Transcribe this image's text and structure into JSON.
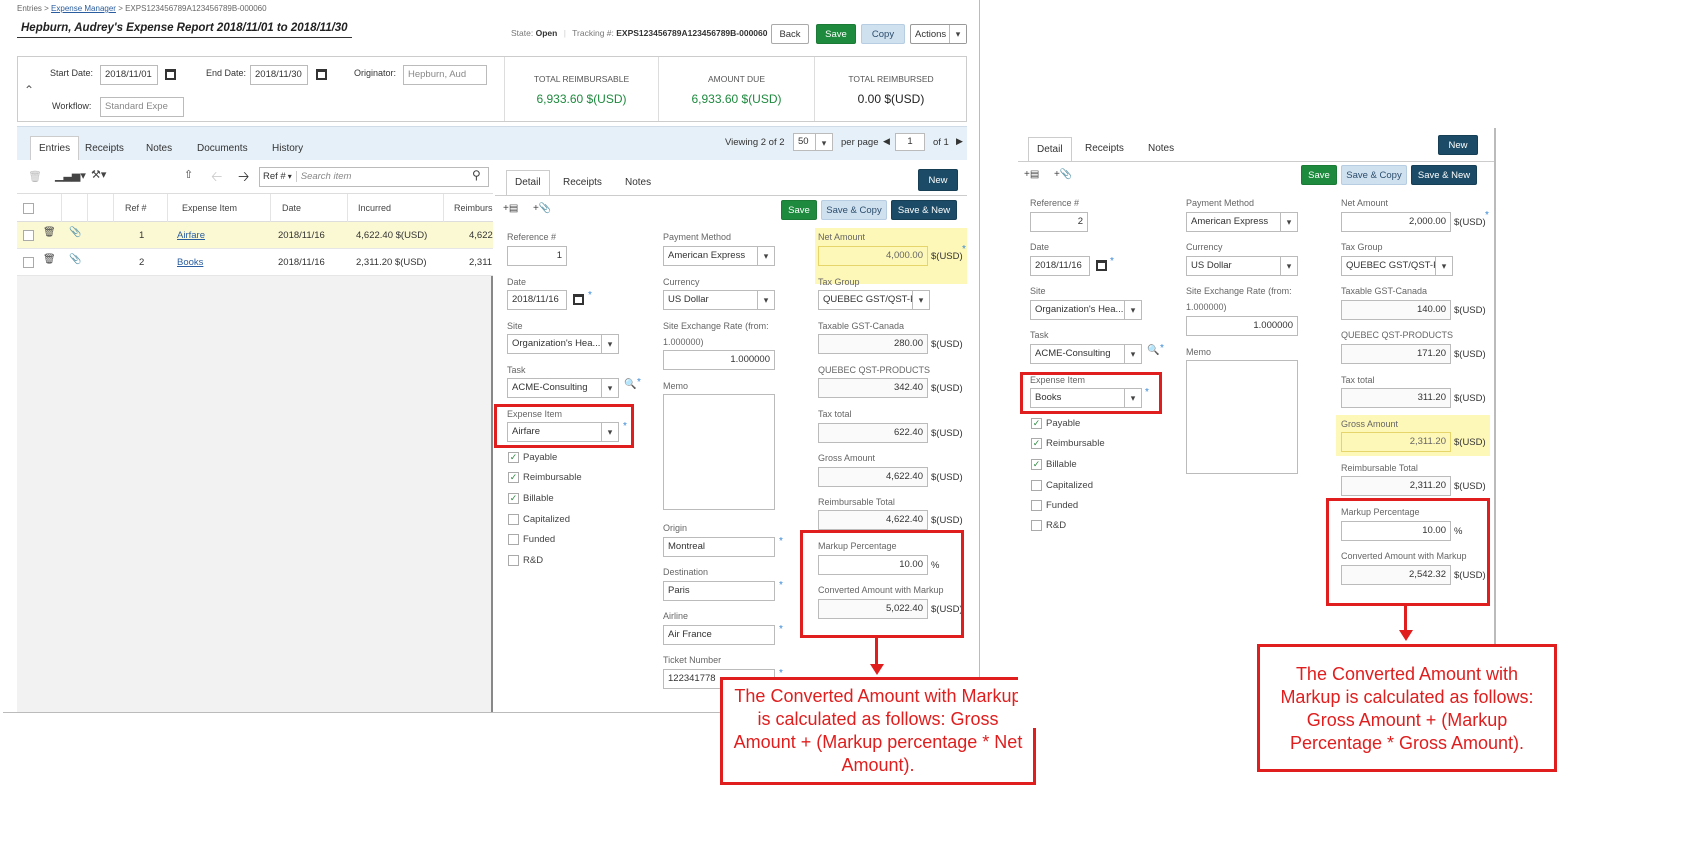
{
  "main": {
    "breadcrumb": {
      "root": "Entries >",
      "link": "Expense Manager",
      "rest": "> EXPS123456789A123456789B-000060"
    },
    "title": "Hepburn, Audrey's Expense Report 2018/11/01 to 2018/11/30",
    "state_label": "State:",
    "state_value": "Open",
    "tracking_label": "Tracking #:",
    "tracking_value": "EXPS123456789A123456789B-000060",
    "buttons": {
      "back": "Back",
      "save": "Save",
      "copy": "Copy",
      "actions": "Actions"
    },
    "header": {
      "start_label": "Start Date:",
      "start_value": "2018/11/01",
      "end_label": "End Date:",
      "end_value": "2018/11/30",
      "originator_label": "Originator:",
      "originator_value": "Hepburn, Aud",
      "workflow_label": "Workflow:",
      "workflow_value": "Standard Expe"
    },
    "totals": [
      {
        "label": "TOTAL REIMBURSABLE",
        "value": "6,933.60 $(USD)"
      },
      {
        "label": "AMOUNT DUE",
        "value": "6,933.60 $(USD)"
      },
      {
        "label": "TOTAL REIMBURSED",
        "value": "0.00 $(USD)"
      }
    ],
    "tabs": {
      "entries": "Entries",
      "receipts": "Receipts",
      "notes": "Notes",
      "documents": "Documents",
      "history": "History"
    },
    "paging": {
      "viewing": "Viewing 2 of 2",
      "per_page_value": "50",
      "per_page_label": "per page",
      "page": "1",
      "of": "of 1"
    },
    "search": {
      "field": "Ref #",
      "placeholder": "Search item"
    },
    "columns": {
      "ref": "Ref #",
      "item": "Expense Item",
      "date": "Date",
      "incurred": "Incurred",
      "reimb": "Reimburs"
    },
    "rows": [
      {
        "ref": "1",
        "item": "Airfare",
        "date": "2018/11/16",
        "incurred": "4,622.40 $(USD)",
        "reimb": "4,622"
      },
      {
        "ref": "2",
        "item": "Books",
        "date": "2018/11/16",
        "incurred": "2,311.20 $(USD)",
        "reimb": "2,311"
      }
    ]
  },
  "detail_left": {
    "tabs": {
      "detail": "Detail",
      "receipts": "Receipts",
      "notes": "Notes"
    },
    "buttons": {
      "new": "New",
      "save": "Save",
      "save_copy": "Save & Copy",
      "save_new": "Save & New"
    },
    "labels": {
      "ref": "Reference #",
      "date": "Date",
      "site": "Site",
      "task": "Task",
      "expense_item": "Expense Item",
      "payment": "Payment Method",
      "currency": "Currency",
      "rate": "Site Exchange Rate",
      "rate_from": "(from:",
      "rate_from_value": "1.000000)",
      "memo": "Memo",
      "origin": "Origin",
      "destination": "Destination",
      "airline": "Airline",
      "ticket": "Ticket Number",
      "net": "Net Amount",
      "tax_group": "Tax Group",
      "taxable_gst": "Taxable GST-Canada",
      "qst": "QUEBEC QST-PRODUCTS",
      "tax_total": "Tax total",
      "gross": "Gross Amount",
      "reimb_total": "Reimbursable Total",
      "markup": "Markup Percentage",
      "converted": "Converted Amount with Markup"
    },
    "values": {
      "ref": "1",
      "date": "2018/11/16",
      "site": "Organization's Hea...",
      "task": "ACME-Consulting",
      "expense_item": "Airfare",
      "payment": "American Express",
      "currency": "US Dollar",
      "rate": "1.000000",
      "origin": "Montreal",
      "destination": "Paris",
      "airline": "Air France",
      "ticket": "122341778",
      "net": "4,000.00",
      "tax_group": "QUEBEC GST/QST-P...",
      "taxable_gst": "280.00",
      "qst": "342.40",
      "tax_total": "622.40",
      "gross": "4,622.40",
      "reimb_total": "4,622.40",
      "markup": "10.00",
      "converted": "5,022.40"
    },
    "unit": "$(USD)",
    "pct": "%",
    "checks": [
      {
        "label": "Payable",
        "checked": true
      },
      {
        "label": "Reimbursable",
        "checked": true
      },
      {
        "label": "Billable",
        "checked": true
      },
      {
        "label": "Capitalized",
        "checked": false
      },
      {
        "label": "Funded",
        "checked": false
      },
      {
        "label": "R&D",
        "checked": false
      }
    ],
    "callout": "The Converted Amount with Markup is calculated as follows: Gross Amount + (Markup percentage * Net Amount)."
  },
  "detail_right": {
    "tabs": {
      "detail": "Detail",
      "receipts": "Receipts",
      "notes": "Notes"
    },
    "buttons": {
      "new": "New",
      "save": "Save",
      "save_copy": "Save & Copy",
      "save_new": "Save & New"
    },
    "values": {
      "ref": "2",
      "date": "2018/11/16",
      "site": "Organization's Hea...",
      "task": "ACME-Consulting",
      "expense_item": "Books",
      "payment": "American Express",
      "currency": "US Dollar",
      "rate": "1.000000",
      "net": "2,000.00",
      "tax_group": "QUEBEC GST/QST-P...",
      "taxable_gst": "140.00",
      "qst": "171.20",
      "tax_total": "311.20",
      "gross": "2,311.20",
      "reimb_total": "2,311.20",
      "markup": "10.00",
      "converted": "2,542.32"
    },
    "checks": [
      {
        "label": "Payable",
        "checked": true
      },
      {
        "label": "Reimbursable",
        "checked": true
      },
      {
        "label": "Billable",
        "checked": true
      },
      {
        "label": "Capitalized",
        "checked": false
      },
      {
        "label": "Funded",
        "checked": false
      },
      {
        "label": "R&D",
        "checked": false
      }
    ],
    "callout": "The Converted Amount with Markup is calculated as follows: Gross Amount + (Markup Percentage * Gross Amount)."
  },
  "colors": {
    "accent_green": "#1e8a3e",
    "accent_navy": "#1b4b66",
    "callout_red": "#e01e1e",
    "highlight": "#fdf7b8"
  }
}
